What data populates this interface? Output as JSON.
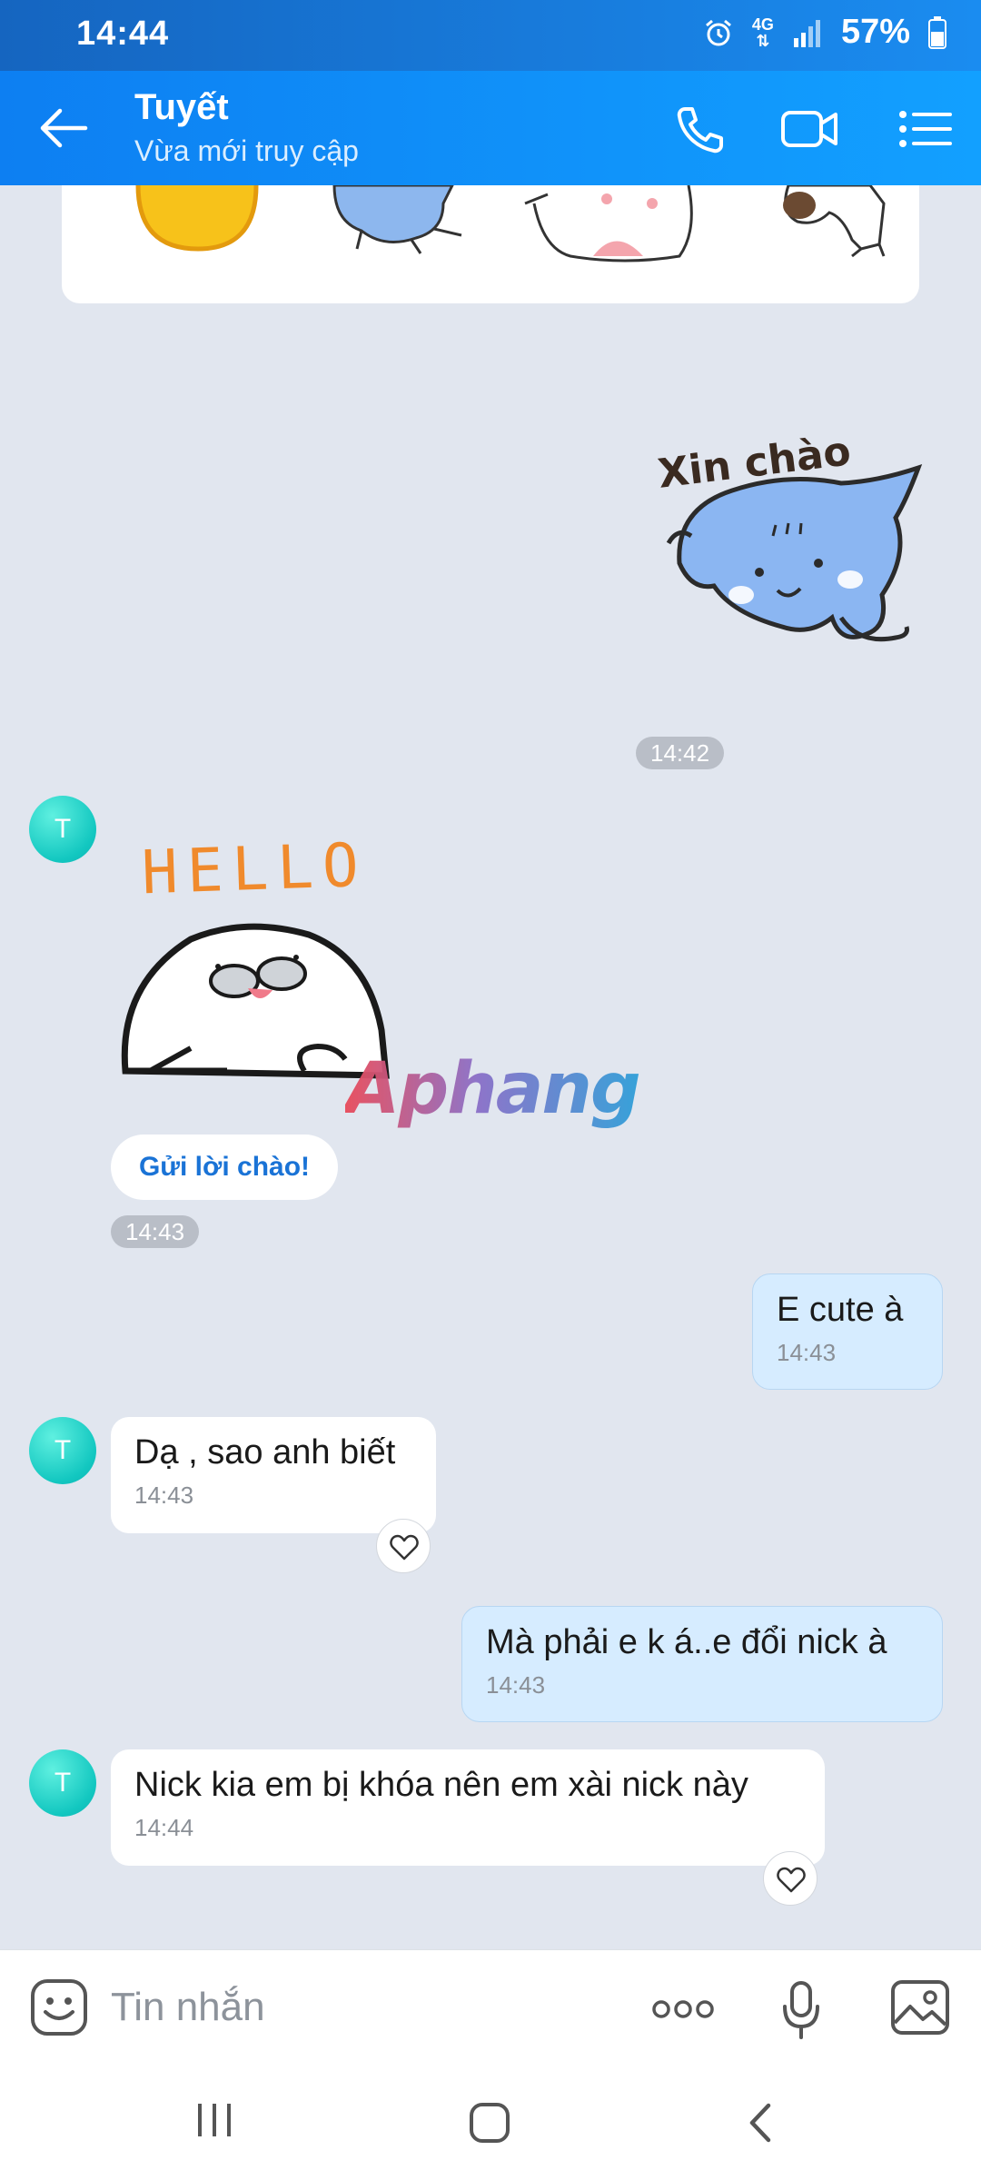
{
  "status_bar": {
    "time": "14:44",
    "network": "4G",
    "battery": "57%"
  },
  "header": {
    "contact_name": "Tuyết",
    "contact_status": "Vừa mới truy cập",
    "icons": [
      "back-arrow-icon",
      "phone-icon",
      "video-call-icon",
      "menu-list-icon"
    ]
  },
  "chat": {
    "sticker_out_caption": "Xin chào",
    "sticker_out_time": "14:42",
    "avatar_initial": "T",
    "sticker_in_caption": "HELLO",
    "greet_button": "Gửi lời chào!",
    "sticker_in_time": "14:43",
    "messages": [
      {
        "direction": "out",
        "text": "E cute à",
        "time": "14:43"
      },
      {
        "direction": "in",
        "text": "Dạ , sao anh biết",
        "time": "14:43"
      },
      {
        "direction": "out",
        "text": "Mà phải e k á..e đổi nick à",
        "time": "14:43"
      },
      {
        "direction": "in",
        "text": "Nick kia em bị khóa nên em xài nick này",
        "time": "14:44"
      }
    ],
    "watermark": "Aphang"
  },
  "input_bar": {
    "placeholder": "Tin nhắn"
  },
  "colors": {
    "header": "#0d7ff2",
    "chat_bg": "#e1e6ef",
    "out_bubble": "#d6ecff",
    "in_bubble": "#ffffff",
    "avatar": "#12c7c0"
  }
}
